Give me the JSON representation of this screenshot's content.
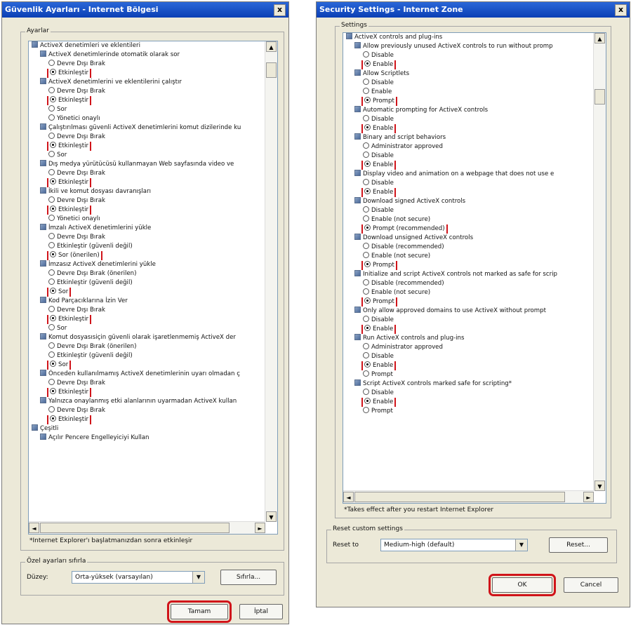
{
  "left": {
    "title": "Güvenlik Ayarları - Internet Bölgesi",
    "close_label": "x",
    "settings_group": "Ayarlar",
    "rows": [
      {
        "lvl": 0,
        "kind": "set",
        "text": "ActiveX denetimleri ve eklentileri"
      },
      {
        "lvl": 1,
        "kind": "set",
        "text": "ActiveX denetimlerinde otomatik olarak sor"
      },
      {
        "lvl": 2,
        "kind": "opt",
        "on": false,
        "text": "Devre Dışı Bırak"
      },
      {
        "lvl": 2,
        "kind": "opt",
        "on": true,
        "hl": true,
        "text": "Etkinleştir"
      },
      {
        "lvl": 1,
        "kind": "set",
        "text": "ActiveX denetimlerini ve eklentilerini çalıştır"
      },
      {
        "lvl": 2,
        "kind": "opt",
        "on": false,
        "text": "Devre Dışı Bırak"
      },
      {
        "lvl": 2,
        "kind": "opt",
        "on": true,
        "hl": true,
        "text": "Etkinleştir"
      },
      {
        "lvl": 2,
        "kind": "opt",
        "on": false,
        "text": "Sor"
      },
      {
        "lvl": 2,
        "kind": "opt",
        "on": false,
        "text": "Yönetici onaylı"
      },
      {
        "lvl": 1,
        "kind": "set",
        "text": "Çalıştırılması güvenli ActiveX denetimlerini komut dizilerinde ku"
      },
      {
        "lvl": 2,
        "kind": "opt",
        "on": false,
        "text": "Devre Dışı Bırak"
      },
      {
        "lvl": 2,
        "kind": "opt",
        "on": true,
        "hl": true,
        "text": "Etkinleştir"
      },
      {
        "lvl": 2,
        "kind": "opt",
        "on": false,
        "text": "Sor"
      },
      {
        "lvl": 1,
        "kind": "set",
        "text": "Dış medya yürütücüsü kullanmayan Web sayfasında video ve"
      },
      {
        "lvl": 2,
        "kind": "opt",
        "on": false,
        "text": "Devre Dışı Bırak"
      },
      {
        "lvl": 2,
        "kind": "opt",
        "on": true,
        "hl": true,
        "text": "Etkinleştir"
      },
      {
        "lvl": 1,
        "kind": "set",
        "text": "İkili ve komut dosyası davranışları"
      },
      {
        "lvl": 2,
        "kind": "opt",
        "on": false,
        "text": "Devre Dışı Bırak"
      },
      {
        "lvl": 2,
        "kind": "opt",
        "on": true,
        "hl": true,
        "text": "Etkinleştir"
      },
      {
        "lvl": 2,
        "kind": "opt",
        "on": false,
        "text": "Yönetici onaylı"
      },
      {
        "lvl": 1,
        "kind": "set",
        "text": "İmzalı ActiveX denetimlerini yükle"
      },
      {
        "lvl": 2,
        "kind": "opt",
        "on": false,
        "text": "Devre Dışı Bırak"
      },
      {
        "lvl": 2,
        "kind": "opt",
        "on": false,
        "text": "Etkinleştir (güvenli değil)"
      },
      {
        "lvl": 2,
        "kind": "opt",
        "on": true,
        "hl": true,
        "text": "Sor (önerilen)"
      },
      {
        "lvl": 1,
        "kind": "set",
        "text": "İmzasız ActiveX denetimlerini yükle"
      },
      {
        "lvl": 2,
        "kind": "opt",
        "on": false,
        "text": "Devre Dışı Bırak (önerilen)"
      },
      {
        "lvl": 2,
        "kind": "opt",
        "on": false,
        "text": "Etkinleştir (güvenli değil)"
      },
      {
        "lvl": 2,
        "kind": "opt",
        "on": true,
        "hl": true,
        "text": "Sor"
      },
      {
        "lvl": 1,
        "kind": "set",
        "text": "Kod Parçacıklarına İzin Ver"
      },
      {
        "lvl": 2,
        "kind": "opt",
        "on": false,
        "text": "Devre Dışı Bırak"
      },
      {
        "lvl": 2,
        "kind": "opt",
        "on": true,
        "hl": true,
        "text": "Etkinleştir"
      },
      {
        "lvl": 2,
        "kind": "opt",
        "on": false,
        "text": "Sor"
      },
      {
        "lvl": 1,
        "kind": "set",
        "text": "Komut dosyasısiçin güvenli olarak işaretlenmemiş ActiveX der"
      },
      {
        "lvl": 2,
        "kind": "opt",
        "on": false,
        "text": "Devre Dışı Bırak (önerilen)"
      },
      {
        "lvl": 2,
        "kind": "opt",
        "on": false,
        "text": "Etkinleştir (güvenli değil)"
      },
      {
        "lvl": 2,
        "kind": "opt",
        "on": true,
        "hl": true,
        "text": "Sor"
      },
      {
        "lvl": 1,
        "kind": "set",
        "text": "Önceden kullanılmamış ActiveX denetimlerinin uyarı olmadan ç"
      },
      {
        "lvl": 2,
        "kind": "opt",
        "on": false,
        "text": "Devre Dışı Bırak"
      },
      {
        "lvl": 2,
        "kind": "opt",
        "on": true,
        "hl": true,
        "text": "Etkinleştir"
      },
      {
        "lvl": 1,
        "kind": "set",
        "text": "Yalnızca onaylanmış etki alanlarının uyarmadan ActiveX kullan"
      },
      {
        "lvl": 2,
        "kind": "opt",
        "on": false,
        "text": "Devre Dışı Bırak"
      },
      {
        "lvl": 2,
        "kind": "opt",
        "on": true,
        "hl": true,
        "text": "Etkinleştir"
      },
      {
        "lvl": 0,
        "kind": "set",
        "text": "Çeşitli"
      },
      {
        "lvl": 1,
        "kind": "set",
        "text": "Açılır Pencere Engelleyiciyi Kullan"
      }
    ],
    "note": "*Internet Explorer'ı başlatmanızdan sonra etkinleşir",
    "reset_group": "Özel ayarları sıfırla",
    "reset_label": "Düzey:",
    "reset_value": "Orta-yüksek (varsayılan)",
    "reset_button": "Sıfırla...",
    "ok_button": "Tamam",
    "cancel_button": "İptal"
  },
  "right": {
    "title": "Security Settings - Internet Zone",
    "close_label": "x",
    "settings_group": "Settings",
    "rows": [
      {
        "lvl": 0,
        "kind": "set",
        "text": "ActiveX controls and plug-ins"
      },
      {
        "lvl": 1,
        "kind": "set",
        "text": "Allow previously unused ActiveX controls to run without promp"
      },
      {
        "lvl": 2,
        "kind": "opt",
        "on": false,
        "text": "Disable"
      },
      {
        "lvl": 2,
        "kind": "opt",
        "on": true,
        "hl": true,
        "text": "Enable"
      },
      {
        "lvl": 1,
        "kind": "set",
        "text": "Allow Scriptlets"
      },
      {
        "lvl": 2,
        "kind": "opt",
        "on": false,
        "text": "Disable"
      },
      {
        "lvl": 2,
        "kind": "opt",
        "on": false,
        "text": "Enable"
      },
      {
        "lvl": 2,
        "kind": "opt",
        "on": true,
        "hl": true,
        "text": "Prompt"
      },
      {
        "lvl": 1,
        "kind": "set",
        "text": "Automatic prompting for ActiveX controls"
      },
      {
        "lvl": 2,
        "kind": "opt",
        "on": false,
        "text": "Disable"
      },
      {
        "lvl": 2,
        "kind": "opt",
        "on": true,
        "hl": true,
        "text": "Enable"
      },
      {
        "lvl": 1,
        "kind": "set",
        "text": "Binary and script behaviors"
      },
      {
        "lvl": 2,
        "kind": "opt",
        "on": false,
        "text": "Administrator approved"
      },
      {
        "lvl": 2,
        "kind": "opt",
        "on": false,
        "text": "Disable"
      },
      {
        "lvl": 2,
        "kind": "opt",
        "on": true,
        "hl": true,
        "text": "Enable"
      },
      {
        "lvl": 1,
        "kind": "set",
        "text": "Display video and animation on a webpage that does not use e"
      },
      {
        "lvl": 2,
        "kind": "opt",
        "on": false,
        "text": "Disable"
      },
      {
        "lvl": 2,
        "kind": "opt",
        "on": true,
        "hl": true,
        "text": "Enable"
      },
      {
        "lvl": 1,
        "kind": "set",
        "text": "Download signed ActiveX controls"
      },
      {
        "lvl": 2,
        "kind": "opt",
        "on": false,
        "text": "Disable"
      },
      {
        "lvl": 2,
        "kind": "opt",
        "on": false,
        "text": "Enable (not secure)"
      },
      {
        "lvl": 2,
        "kind": "opt",
        "on": true,
        "hl": true,
        "text": "Prompt (recommended)"
      },
      {
        "lvl": 1,
        "kind": "set",
        "text": "Download unsigned ActiveX controls"
      },
      {
        "lvl": 2,
        "kind": "opt",
        "on": false,
        "text": "Disable (recommended)"
      },
      {
        "lvl": 2,
        "kind": "opt",
        "on": false,
        "text": "Enable (not secure)"
      },
      {
        "lvl": 2,
        "kind": "opt",
        "on": true,
        "hl": true,
        "text": "Prompt"
      },
      {
        "lvl": 1,
        "kind": "set",
        "text": "Initialize and script ActiveX controls not marked as safe for scrip"
      },
      {
        "lvl": 2,
        "kind": "opt",
        "on": false,
        "text": "Disable (recommended)"
      },
      {
        "lvl": 2,
        "kind": "opt",
        "on": false,
        "text": "Enable (not secure)"
      },
      {
        "lvl": 2,
        "kind": "opt",
        "on": true,
        "hl": true,
        "text": "Prompt"
      },
      {
        "lvl": 1,
        "kind": "set",
        "text": "Only allow approved domains to use ActiveX without prompt"
      },
      {
        "lvl": 2,
        "kind": "opt",
        "on": false,
        "text": "Disable"
      },
      {
        "lvl": 2,
        "kind": "opt",
        "on": true,
        "hl": true,
        "text": "Enable"
      },
      {
        "lvl": 1,
        "kind": "set",
        "text": "Run ActiveX controls and plug-ins"
      },
      {
        "lvl": 2,
        "kind": "opt",
        "on": false,
        "text": "Administrator approved"
      },
      {
        "lvl": 2,
        "kind": "opt",
        "on": false,
        "text": "Disable"
      },
      {
        "lvl": 2,
        "kind": "opt",
        "on": true,
        "hl": true,
        "text": "Enable"
      },
      {
        "lvl": 2,
        "kind": "opt",
        "on": false,
        "text": "Prompt"
      },
      {
        "lvl": 1,
        "kind": "set",
        "text": "Script ActiveX controls marked safe for scripting*"
      },
      {
        "lvl": 2,
        "kind": "opt",
        "on": false,
        "text": "Disable"
      },
      {
        "lvl": 2,
        "kind": "opt",
        "on": true,
        "hl": true,
        "text": "Enable"
      },
      {
        "lvl": 2,
        "kind": "opt",
        "on": false,
        "text": "Prompt"
      }
    ],
    "note": "*Takes effect after you restart Internet Explorer",
    "reset_group": "Reset custom settings",
    "reset_label": "Reset to",
    "reset_value": "Medium-high (default)",
    "reset_button": "Reset...",
    "ok_button": "OK",
    "cancel_button": "Cancel"
  },
  "colors": {
    "highlight": "#d0141a",
    "titlebar": "#0b3fb5",
    "dialog": "#ece9d8"
  }
}
